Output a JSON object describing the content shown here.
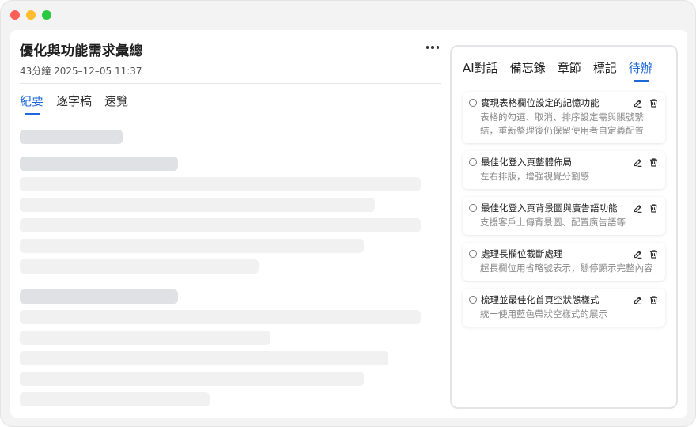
{
  "window": {
    "controls": [
      "close",
      "minimize",
      "maximize"
    ]
  },
  "header": {
    "title": "優化與功能需求彙總",
    "meta": "43分鐘 2025–12–05 11:37",
    "more_icon": "more-horizontal-icon"
  },
  "left_tabs": [
    {
      "label": "紀要",
      "active": true
    },
    {
      "label": "逐字稿",
      "active": false
    },
    {
      "label": "速覽",
      "active": false
    }
  ],
  "right_tabs": [
    {
      "label": "AI對話",
      "active": false
    },
    {
      "label": "備忘錄",
      "active": false
    },
    {
      "label": "章節",
      "active": false
    },
    {
      "label": "標記",
      "active": false
    },
    {
      "label": "待辦",
      "active": true
    }
  ],
  "todos": [
    {
      "title": "實現表格欄位設定的記憶功能",
      "desc": [
        "表格的勾選、取消、排序設定需與賬號繫",
        "結，重新整理後仍保留使用者自定義配置"
      ]
    },
    {
      "title": "最佳化登入頁整體佈局",
      "desc": [
        "左右排版，增強視覺分割感"
      ]
    },
    {
      "title": "最佳化登入頁背景圖與廣告語功能",
      "desc": [
        "支援客戶上傳背景圖、配置廣告語等"
      ]
    },
    {
      "title": "處理長欄位截斷處理",
      "desc": [
        "超長欄位用省略號表示，懸停顯示完整內容"
      ]
    },
    {
      "title": "梳理並最佳化首頁空狀態樣式",
      "desc": [
        "統一使用藍色帶狀空樣式的展示"
      ]
    }
  ],
  "colors": {
    "accent": "#1d68d8",
    "skeleton": "#f1f1f2",
    "skeleton_dark": "#e0e1e4"
  }
}
